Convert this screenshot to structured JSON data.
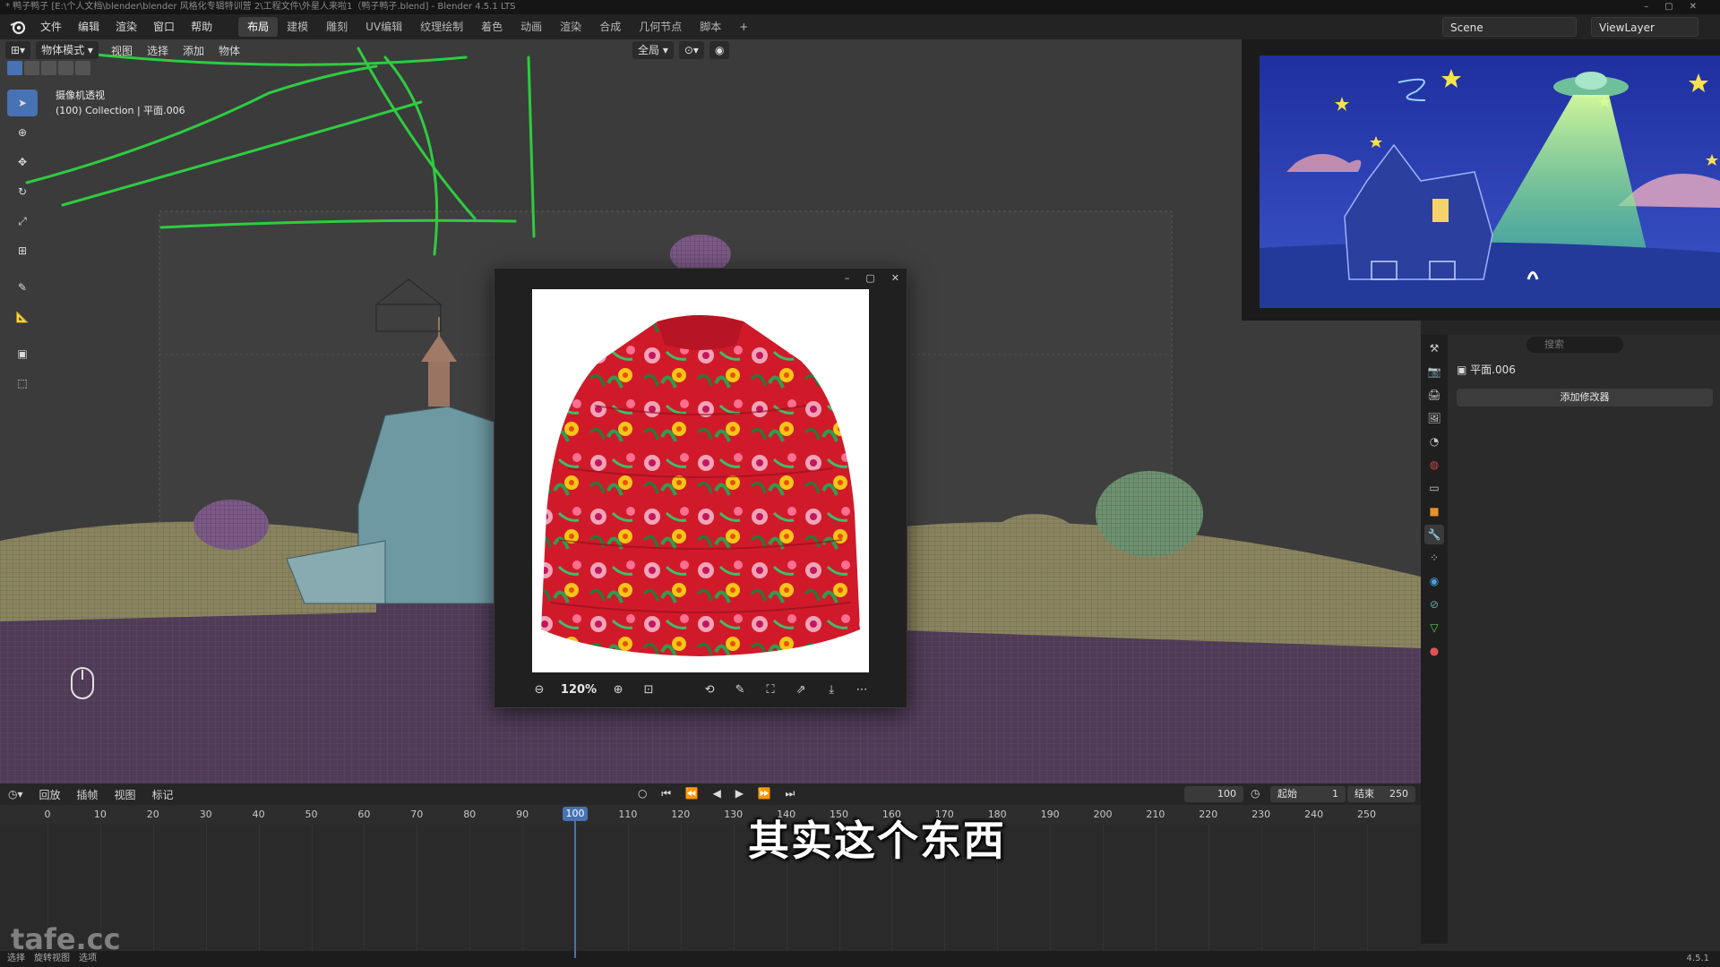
{
  "window": {
    "title": "* 鸭子鸭子 [E:\\个人文档\\blender\\blender 风格化专辑特训营 2\\工程文件\\外星人来啦1（鸭子鸭子.blend] - Blender 4.5.1 LTS"
  },
  "menubar": {
    "items": [
      "文件",
      "编辑",
      "渲染",
      "窗口",
      "帮助"
    ],
    "workspaces": [
      "布局",
      "建模",
      "雕刻",
      "UV编辑",
      "纹理绘制",
      "着色",
      "动画",
      "渲染",
      "合成",
      "几何节点",
      "脚本"
    ],
    "active_workspace": "布局",
    "add_tab": "+",
    "scene_name": "Scene",
    "view_layer": "ViewLayer"
  },
  "viewport": {
    "mode": "物体模式",
    "menus": [
      "视图",
      "选择",
      "添加",
      "物体"
    ],
    "transform_orientation": "全局",
    "overlay_line1": "摄像机透视",
    "overlay_line2": "(100) Collection | 平面.006"
  },
  "image_viewer": {
    "zoom": "120%",
    "subject": "red floral padded jacket"
  },
  "properties": {
    "search_placeholder": "搜索",
    "object_name": "平面.006",
    "add_modifier": "添加修改器"
  },
  "timeline": {
    "menus": [
      "回放",
      "插帧",
      "视图",
      "标记"
    ],
    "current_frame": "100",
    "start_label": "起始",
    "start_value": "1",
    "end_label": "结束",
    "end_value": "250",
    "ticks": [
      "0",
      "10",
      "20",
      "30",
      "40",
      "50",
      "60",
      "70",
      "80",
      "90",
      "100",
      "110",
      "120",
      "130",
      "140",
      "150",
      "160",
      "170",
      "180",
      "190",
      "200",
      "210",
      "220",
      "230",
      "240",
      "250"
    ],
    "playhead_frame": 100
  },
  "subtitle": "其实这个东西",
  "watermark": "tafe.cc",
  "statusbar": {
    "items": [
      "选择",
      "旋转视图",
      "选项"
    ],
    "version": "4.5.1"
  },
  "colors": {
    "accent": "#4772b3",
    "grease_pencil": "#2ecc40"
  }
}
